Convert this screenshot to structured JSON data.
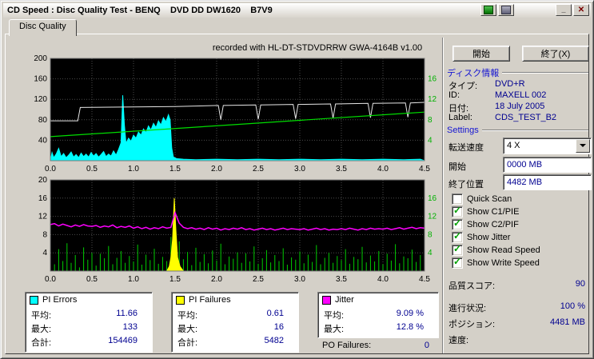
{
  "window": {
    "title": "CD Speed : Disc Quality Test - BENQ    DVD DD DW1620    B7V9",
    "controls": {
      "minimize": "_",
      "close": "✕"
    }
  },
  "tab": {
    "label": "Disc Quality"
  },
  "chart_header": "recorded with HL-DT-STDVDRRW GWA-4164B v1.00",
  "buttons": {
    "start": "開始",
    "exit": "終了(X)"
  },
  "disc_info": {
    "header": "ディスク情報",
    "rows": [
      {
        "label": "タイプ:",
        "value": "DVD+R"
      },
      {
        "label": "ID:",
        "value": "MAXELL 002"
      },
      {
        "label": "日付:",
        "value": "18 July 2005"
      },
      {
        "label": "Label:",
        "value": "CDS_TEST_B2"
      }
    ]
  },
  "settings": {
    "header": "Settings",
    "speed_label": "転送速度",
    "speed_value": "4 X",
    "start_label": "開始",
    "start_value": "0000 MB",
    "end_label": "終了位置",
    "end_value": "4482 MB",
    "checkboxes": [
      {
        "label": "Quick Scan",
        "checked": false
      },
      {
        "label": "Show C1/PIE",
        "checked": true
      },
      {
        "label": "Show C2/PIF",
        "checked": true
      },
      {
        "label": "Show Jitter",
        "checked": true
      },
      {
        "label": "Show Read Speed",
        "checked": true
      },
      {
        "label": "Show Write Speed",
        "checked": true
      }
    ]
  },
  "status": {
    "score_label": "品質スコア:",
    "score_value": "90",
    "progress_label": "進行状況:",
    "progress_value": "100 %",
    "position_label": "ポジション:",
    "position_value": "4481 MB",
    "speed_label": "速度:",
    "speed_value": ""
  },
  "stats": {
    "pi_errors": {
      "title": "PI Errors",
      "color": "#00ffff",
      "rows": [
        {
          "label": "平均:",
          "value": "11.66"
        },
        {
          "label": "最大:",
          "value": "133"
        },
        {
          "label": "合計:",
          "value": "154469"
        }
      ]
    },
    "pi_failures": {
      "title": "PI Failures",
      "color": "#ffff00",
      "rows": [
        {
          "label": "平均:",
          "value": "0.61"
        },
        {
          "label": "最大:",
          "value": "16"
        },
        {
          "label": "合計:",
          "value": "5482"
        }
      ]
    },
    "jitter": {
      "title": "Jitter",
      "color": "#ff00ff",
      "rows": [
        {
          "label": "平均:",
          "value": "9.09 %"
        },
        {
          "label": "最大:",
          "value": "12.8 %"
        }
      ]
    },
    "po_label": "PO Failures:",
    "po_value": "0"
  },
  "icons": {
    "check": "✓"
  },
  "chart_data": [
    {
      "id": "quality-top",
      "type": "area",
      "title": "recorded with HL-DT-STDVDRRW GWA-4164B v1.00",
      "margins": {
        "l": 36,
        "r": 22,
        "t": 24,
        "b": 18
      },
      "x": {
        "min": 0,
        "max": 4.5,
        "ticks": [
          0,
          0.5,
          1,
          1.5,
          2,
          2.5,
          3,
          3.5,
          4,
          4.5
        ],
        "tick_labels": [
          "0.0",
          "0.5",
          "1.0",
          "1.5",
          "2.0",
          "2.5",
          "3.0",
          "3.5",
          "4.0",
          "4.5"
        ]
      },
      "y_left": {
        "min": 0,
        "max": 200,
        "ticks": [
          40,
          80,
          120,
          160,
          200
        ]
      },
      "y_right": {
        "color": "#00b000",
        "ticks": [
          {
            "label": "4",
            "at": 40
          },
          {
            "label": "8",
            "at": 80
          },
          {
            "label": "12",
            "at": 120
          },
          {
            "label": "16",
            "at": 160
          }
        ]
      },
      "series": [
        {
          "name": "pi-errors",
          "legend": "PI Errors",
          "type": "area",
          "color": "#00ffff",
          "points": [
            [
              0,
              0
            ],
            [
              0.02,
              16
            ],
            [
              0.04,
              6
            ],
            [
              0.07,
              13
            ],
            [
              0.1,
              24
            ],
            [
              0.13,
              8
            ],
            [
              0.16,
              14
            ],
            [
              0.19,
              6
            ],
            [
              0.22,
              11
            ],
            [
              0.25,
              17
            ],
            [
              0.28,
              7
            ],
            [
              0.31,
              12
            ],
            [
              0.34,
              6
            ],
            [
              0.37,
              15
            ],
            [
              0.4,
              8
            ],
            [
              0.43,
              13
            ],
            [
              0.46,
              7
            ],
            [
              0.49,
              16
            ],
            [
              0.52,
              9
            ],
            [
              0.55,
              14
            ],
            [
              0.58,
              7
            ],
            [
              0.61,
              12
            ],
            [
              0.64,
              18
            ],
            [
              0.67,
              8
            ],
            [
              0.7,
              13
            ],
            [
              0.73,
              9
            ],
            [
              0.76,
              19
            ],
            [
              0.79,
              11
            ],
            [
              0.82,
              22
            ],
            [
              0.85,
              35
            ],
            [
              0.87,
              128
            ],
            [
              0.89,
              70
            ],
            [
              0.91,
              34
            ],
            [
              0.94,
              44
            ],
            [
              0.97,
              38
            ],
            [
              1.0,
              50
            ],
            [
              1.03,
              44
            ],
            [
              1.06,
              56
            ],
            [
              1.09,
              50
            ],
            [
              1.12,
              62
            ],
            [
              1.15,
              55
            ],
            [
              1.18,
              68
            ],
            [
              1.21,
              60
            ],
            [
              1.24,
              73
            ],
            [
              1.27,
              65
            ],
            [
              1.3,
              78
            ],
            [
              1.33,
              70
            ],
            [
              1.36,
              84
            ],
            [
              1.39,
              76
            ],
            [
              1.42,
              90
            ],
            [
              1.44,
              80
            ],
            [
              1.46,
              25
            ],
            [
              1.48,
              7
            ],
            [
              1.52,
              4
            ],
            [
              1.6,
              3
            ],
            [
              1.75,
              2
            ],
            [
              2.0,
              3
            ],
            [
              2.25,
              2
            ],
            [
              2.5,
              3
            ],
            [
              2.75,
              2
            ],
            [
              3.0,
              3
            ],
            [
              3.25,
              2
            ],
            [
              3.5,
              3
            ],
            [
              3.75,
              2
            ],
            [
              4.0,
              3
            ],
            [
              4.25,
              2
            ],
            [
              4.45,
              3
            ],
            [
              4.5,
              0
            ]
          ]
        },
        {
          "name": "write-speed",
          "legend": "Write Speed",
          "type": "line",
          "color": "#e6e6e6",
          "width": 1,
          "points": [
            [
              0,
              78
            ],
            [
              0.33,
              78
            ],
            [
              0.36,
              104
            ],
            [
              1.0,
              105
            ],
            [
              1.5,
              106
            ],
            [
              2.02,
              108
            ],
            [
              2.05,
              80
            ],
            [
              2.08,
              108
            ],
            [
              2.47,
              109
            ],
            [
              2.5,
              81
            ],
            [
              2.53,
              109
            ],
            [
              2.92,
              110
            ],
            [
              2.95,
              82
            ],
            [
              2.98,
              110
            ],
            [
              3.37,
              111
            ],
            [
              3.4,
              83
            ],
            [
              3.43,
              111
            ],
            [
              3.82,
              112
            ],
            [
              3.85,
              84
            ],
            [
              3.88,
              112
            ],
            [
              4.27,
              113
            ],
            [
              4.3,
              85
            ],
            [
              4.33,
              113
            ],
            [
              4.5,
              114
            ]
          ]
        },
        {
          "name": "read-speed",
          "legend": "Read Speed",
          "type": "line",
          "color": "#00dd00",
          "width": 1.2,
          "points": [
            [
              0,
              47
            ],
            [
              2.25,
              71
            ],
            [
              4.5,
              95
            ]
          ]
        }
      ]
    },
    {
      "id": "quality-bottom",
      "type": "line",
      "margins": {
        "l": 36,
        "r": 22,
        "t": 8,
        "b": 24
      },
      "x": {
        "min": 0,
        "max": 4.5,
        "ticks": [
          0,
          0.5,
          1,
          1.5,
          2,
          2.5,
          3,
          3.5,
          4,
          4.5
        ],
        "tick_labels": [
          "0.0",
          "0.5",
          "1.0",
          "1.5",
          "2.0",
          "2.5",
          "3.0",
          "3.5",
          "4.0",
          "4.5"
        ]
      },
      "y_left": {
        "min": 0,
        "max": 20,
        "ticks": [
          4,
          8,
          12,
          16,
          20
        ]
      },
      "y_right": {
        "color": "#00b000",
        "ticks": [
          {
            "label": "4",
            "at": 4
          },
          {
            "label": "8",
            "at": 8
          },
          {
            "label": "12",
            "at": 12
          },
          {
            "label": "16",
            "at": 16
          }
        ]
      },
      "series": [
        {
          "name": "pie-detail-spikes",
          "legend": "C1/PIE",
          "type": "spikes",
          "color": "#00cc00",
          "x0": 0,
          "step": 0.05,
          "values": [
            3.2,
            1.5,
            4.8,
            2.2,
            6.1,
            1.8,
            3.5,
            0.8,
            5.2,
            2.5,
            4.0,
            1.2,
            3.8,
            2.8,
            5.5,
            1.5,
            2.9,
            4.4,
            1.8,
            3.3,
            2.1,
            5.8,
            1.4,
            3.6,
            2.4,
            4.9,
            1.6,
            3.1,
            2.2,
            7.5,
            9.0,
            6.5,
            2.6,
            4.2,
            1.3,
            5.1,
            2.0,
            3.7,
            1.7,
            4.5,
            2.3,
            6.0,
            1.5,
            3.2,
            2.7,
            4.1,
            1.8,
            3.9,
            2.1,
            5.4,
            1.6,
            2.8,
            4.6,
            1.9,
            3.5,
            2.2,
            5.0,
            1.4,
            3.0,
            2.5,
            4.3,
            1.7,
            3.6,
            2.0,
            5.7,
            1.5,
            2.9,
            4.0,
            1.8,
            3.3,
            2.4,
            4.8,
            1.6,
            3.1,
            2.6,
            5.3,
            1.9,
            3.4,
            2.1,
            4.4,
            1.5,
            3.8,
            2.3,
            5.9,
            1.7,
            3.2,
            2.8,
            4.7,
            2.0,
            3.5,
            2.6
          ]
        },
        {
          "name": "pi-failures",
          "legend": "PI Failures",
          "type": "area",
          "color": "#ffff00",
          "points": [
            [
              0,
              0
            ],
            [
              1.4,
              0
            ],
            [
              1.43,
              1
            ],
            [
              1.45,
              3
            ],
            [
              1.47,
              7
            ],
            [
              1.49,
              16
            ],
            [
              1.51,
              9
            ],
            [
              1.53,
              3
            ],
            [
              1.56,
              1
            ],
            [
              1.6,
              0
            ],
            [
              4.5,
              0
            ]
          ]
        },
        {
          "name": "jitter",
          "legend": "Jitter",
          "type": "line",
          "color": "#ff00ff",
          "width": 1.5,
          "x0": 0,
          "step": 0.05,
          "values": [
            10.2,
            10.4,
            9.9,
            10.3,
            10.0,
            9.7,
            10.1,
            9.8,
            10.2,
            9.9,
            9.8,
            10.0,
            9.6,
            9.9,
            9.7,
            10.1,
            9.5,
            9.8,
            9.6,
            9.9,
            9.4,
            9.7,
            9.3,
            9.6,
            9.2,
            9.5,
            9.3,
            9.7,
            9.4,
            9.6,
            12.8,
            10.5,
            9.6,
            9.3,
            9.5,
            9.2,
            9.4,
            9.1,
            9.5,
            9.2,
            9.4,
            9.0,
            9.3,
            9.1,
            9.4,
            9.2,
            9.5,
            9.1,
            9.3,
            9.0,
            9.2,
            9.4,
            9.1,
            9.3,
            9.0,
            9.2,
            9.4,
            9.1,
            9.3,
            9.2,
            9.1,
            9.3,
            9.0,
            9.2,
            9.4,
            9.1,
            9.3,
            9.0,
            9.2,
            9.1,
            9.3,
            9.1,
            9.4,
            9.2,
            9.0,
            9.3,
            9.1,
            9.4,
            9.2,
            9.3,
            9.2,
            9.4,
            9.1,
            9.3,
            9.5,
            9.2,
            9.4,
            9.6,
            9.3,
            9.5,
            9.4
          ]
        }
      ]
    }
  ]
}
